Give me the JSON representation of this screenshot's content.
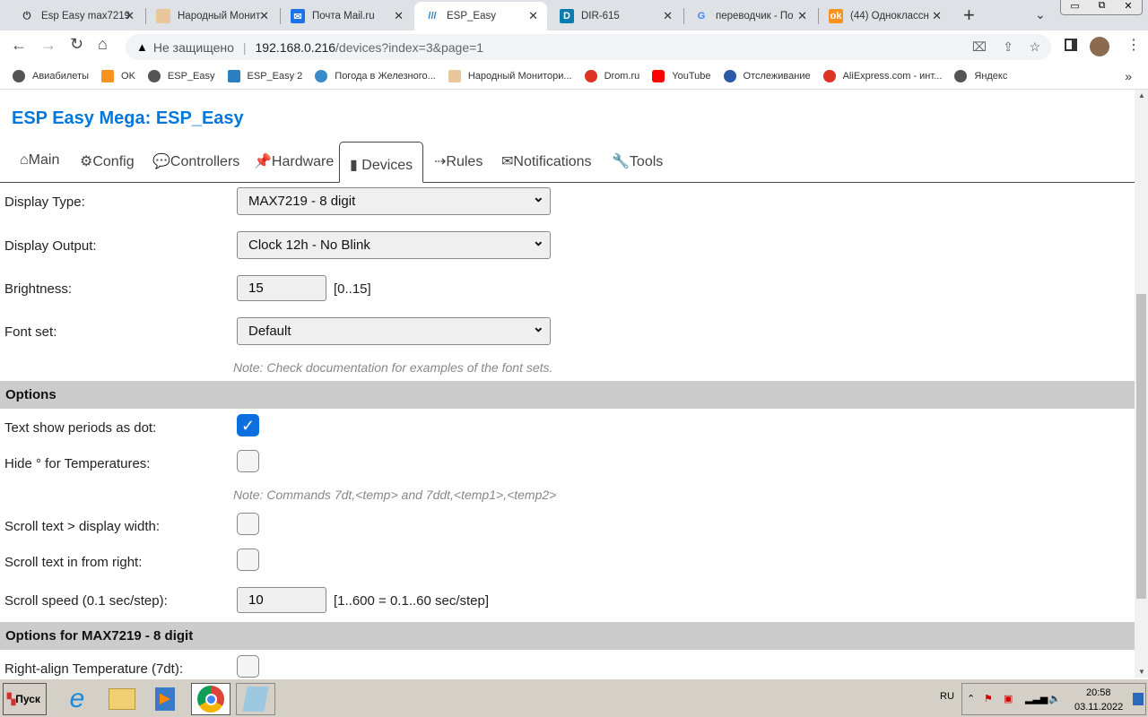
{
  "browser": {
    "tabs": [
      {
        "label": "Esp Easy max7219",
        "icon": "plug-icon"
      },
      {
        "label": "Народный Монит",
        "icon": "thermometer-icon"
      },
      {
        "label": "Почта Mail.ru",
        "icon": "mail-icon"
      },
      {
        "label": "ESP_Easy",
        "icon": "espeasy-icon",
        "active": true
      },
      {
        "label": "DIR-615",
        "icon": "dlink-icon"
      },
      {
        "label": "переводчик - По",
        "icon": "google-icon"
      },
      {
        "label": "(44) Одноклассн",
        "icon": "ok-icon"
      }
    ],
    "security": "Не защищено",
    "url_host": "192.168.0.216",
    "url_path": "/devices?index=3&page=1",
    "bookmarks": [
      "Авиабилеты",
      "OK",
      "ESP_Easy",
      "ESP_Easy 2",
      "Погода в Железного...",
      "Народный Монитори...",
      "Drom.ru",
      "YouTube",
      "Отслеживание",
      "AliExpress.com - инт...",
      "Яндекс"
    ],
    "bookmarks_more": "»"
  },
  "page": {
    "title": "ESP Easy Mega: ESP_Easy",
    "nav": [
      "⌂Main",
      "⚙Config",
      "💬Controllers",
      "📌Hardware",
      "Devices",
      "⇢Rules",
      "✉Notifications",
      "🔧Tools"
    ],
    "display_type": {
      "label": "Display Type:",
      "value": "MAX7219 - 8 digit"
    },
    "display_output": {
      "label": "Display Output:",
      "value": "Clock 12h - No Blink"
    },
    "brightness": {
      "label": "Brightness:",
      "value": "15",
      "range": "[0..15]"
    },
    "font_set": {
      "label": "Font set:",
      "value": "Default"
    },
    "font_note": "Note: Check documentation for examples of the font sets.",
    "options_header": "Options",
    "text_periods": {
      "label": "Text show periods as dot:",
      "checked": true
    },
    "hide_degree": {
      "label": "Hide ° for Temperatures:",
      "checked": false
    },
    "temp_note": "Note: Commands 7dt,<temp> and 7ddt,<temp1>,<temp2>",
    "scroll_width": {
      "label": "Scroll text > display width:",
      "checked": false
    },
    "scroll_right": {
      "label": "Scroll text in from right:",
      "checked": false
    },
    "scroll_speed": {
      "label": "Scroll speed (0.1 sec/step):",
      "value": "10",
      "range": "[1..600 = 0.1..60 sec/step]"
    },
    "max_header": "Options for MAX7219 - 8 digit",
    "right_align": {
      "label": "Right-align Temperature (7dt):",
      "checked": false
    }
  },
  "taskbar": {
    "start": "Пуск",
    "lang": "RU",
    "time": "20:58",
    "date": "03.11.2022"
  },
  "colors": {
    "title": "#0077dd",
    "section": "#cccccc",
    "checkbox_on": "#0b6fe0"
  }
}
